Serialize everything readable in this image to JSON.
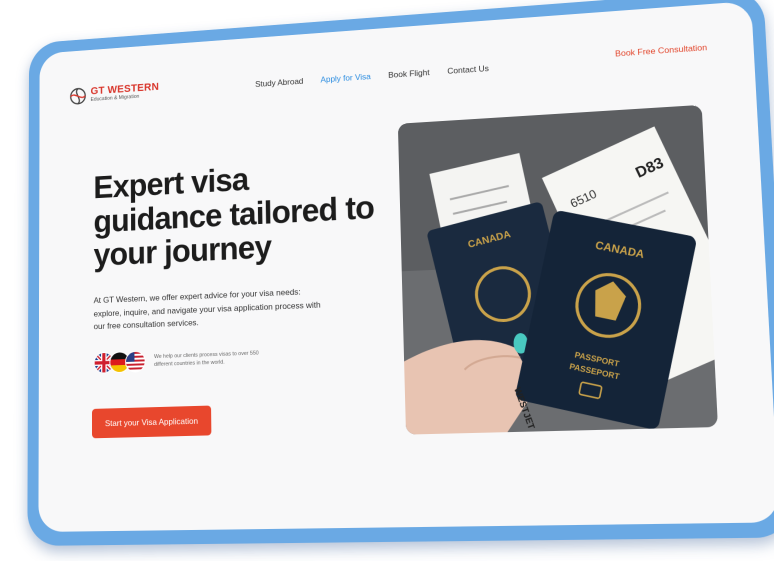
{
  "brand": {
    "name": "GT WESTERN",
    "tagline": "Education & Migration"
  },
  "nav": {
    "items": [
      {
        "label": "Study Abroad",
        "active": false
      },
      {
        "label": "Apply for Visa",
        "active": true
      },
      {
        "label": "Book Flight",
        "active": false
      },
      {
        "label": "Contact Us",
        "active": false
      }
    ]
  },
  "header": {
    "cta_label": "Book Free Consultation"
  },
  "hero": {
    "title_line1": "Expert visa",
    "title_line2": "guidance tailored to",
    "title_line3": "your journey",
    "description": "At GT Western, we offer expert advice for your visa needs: explore, inquire, and navigate your visa application process with our free consultation services.",
    "flags_note": "We help our clients process visas to over 550 different countries in the world.",
    "button_label": "Start your Visa Application"
  },
  "photo": {
    "passport_country": "CANADA",
    "passport_word": "PASSPORT",
    "passport_word_fr": "PASSEPORT",
    "ticket_code": "D83",
    "ticket_code2": "6510",
    "ticket_brand": "WESTJET"
  },
  "colors": {
    "accent": "#e8472d",
    "nav_active": "#2a8ce0",
    "frame": "#6aa9e4",
    "brand_red": "#d8342a"
  },
  "icons": [
    "gt-western-logo-icon",
    "uk-flag-icon",
    "germany-flag-icon",
    "usa-flag-icon"
  ]
}
